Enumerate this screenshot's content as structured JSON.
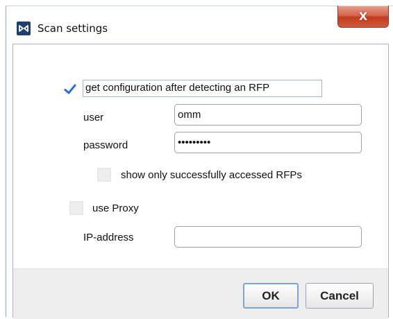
{
  "window": {
    "title": "Scan settings",
    "close_label": "X"
  },
  "form": {
    "get_config": {
      "label": "get configuration after detecting  an RFP",
      "checked": true
    },
    "user": {
      "label": "user",
      "value": "omm"
    },
    "password": {
      "label": "password",
      "value": "omm123456"
    },
    "show_only": {
      "label": "show only successfully accessed RFPs",
      "checked": false
    },
    "use_proxy": {
      "label": "use Proxy",
      "checked": false
    },
    "ip_address": {
      "label": "IP-address",
      "value": ""
    }
  },
  "buttons": {
    "ok": "OK",
    "cancel": "Cancel"
  },
  "colors": {
    "accent": "#2a6fd6",
    "close": "#c94a2d"
  },
  "icons": {
    "app": "scan-app-icon",
    "check": "checkmark-icon"
  }
}
